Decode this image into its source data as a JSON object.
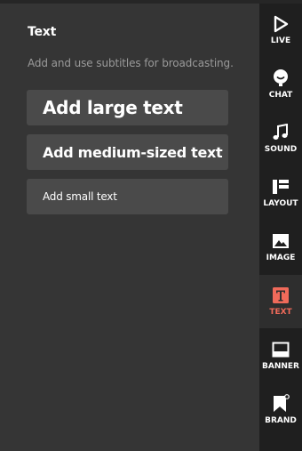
{
  "panel": {
    "title": "Text",
    "description": "Add and use subtitles for broadcasting.",
    "buttons": {
      "large": "Add large text",
      "medium": "Add medium-sized text",
      "small": "Add small text"
    }
  },
  "sidebar": {
    "items": [
      {
        "label": "LIVE",
        "icon": "play-icon"
      },
      {
        "label": "CHAT",
        "icon": "chat-bubble-icon"
      },
      {
        "label": "SOUND",
        "icon": "music-note-icon"
      },
      {
        "label": "LAYOUT",
        "icon": "layout-icon"
      },
      {
        "label": "IMAGE",
        "icon": "image-icon"
      },
      {
        "label": "TEXT",
        "icon": "text-icon",
        "active": true
      },
      {
        "label": "BANNER",
        "icon": "banner-icon"
      },
      {
        "label": "BRAND",
        "icon": "brand-ribbon-icon"
      }
    ],
    "active_color": "#f06a5a"
  },
  "colors": {
    "panel_bg": "#353535",
    "sidebar_bg": "#1f1f1f",
    "button_bg": "#4a4a4a",
    "description_text": "#9a9a9a"
  }
}
